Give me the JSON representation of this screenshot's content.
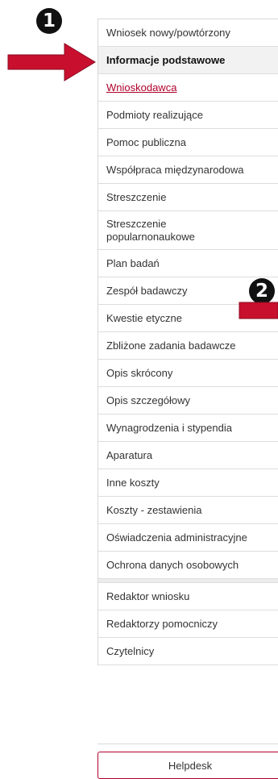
{
  "badges": {
    "one": "1",
    "two": "2"
  },
  "menu": {
    "primary": [
      "Wniosek nowy/powtórzony",
      "Informacje podstawowe",
      "Wnioskodawca",
      "Podmioty realizujące",
      "Pomoc publiczna",
      "Współpraca międzynarodowa",
      "Streszczenie",
      "Streszczenie popularnonaukowe",
      "Plan badań",
      "Zespół badawczy",
      "Kwestie etyczne",
      "Zbliżone zadania badawcze",
      "Opis skrócony",
      "Opis szczegółowy",
      "Wynagrodzenia i stypendia",
      "Aparatura",
      "Inne koszty",
      "Koszty - zestawienia",
      "Oświadczenia administracyjne",
      "Ochrona danych osobowych"
    ],
    "secondary": [
      "Redaktor wniosku",
      "Redaktorzy pomocniczy",
      "Czytelnicy"
    ],
    "helpdesk": "Helpdesk"
  },
  "colors": {
    "accent": "#b0002a",
    "arrow": "#c8102e",
    "badge": "#111111",
    "active_bg": "#f2f2f2"
  }
}
